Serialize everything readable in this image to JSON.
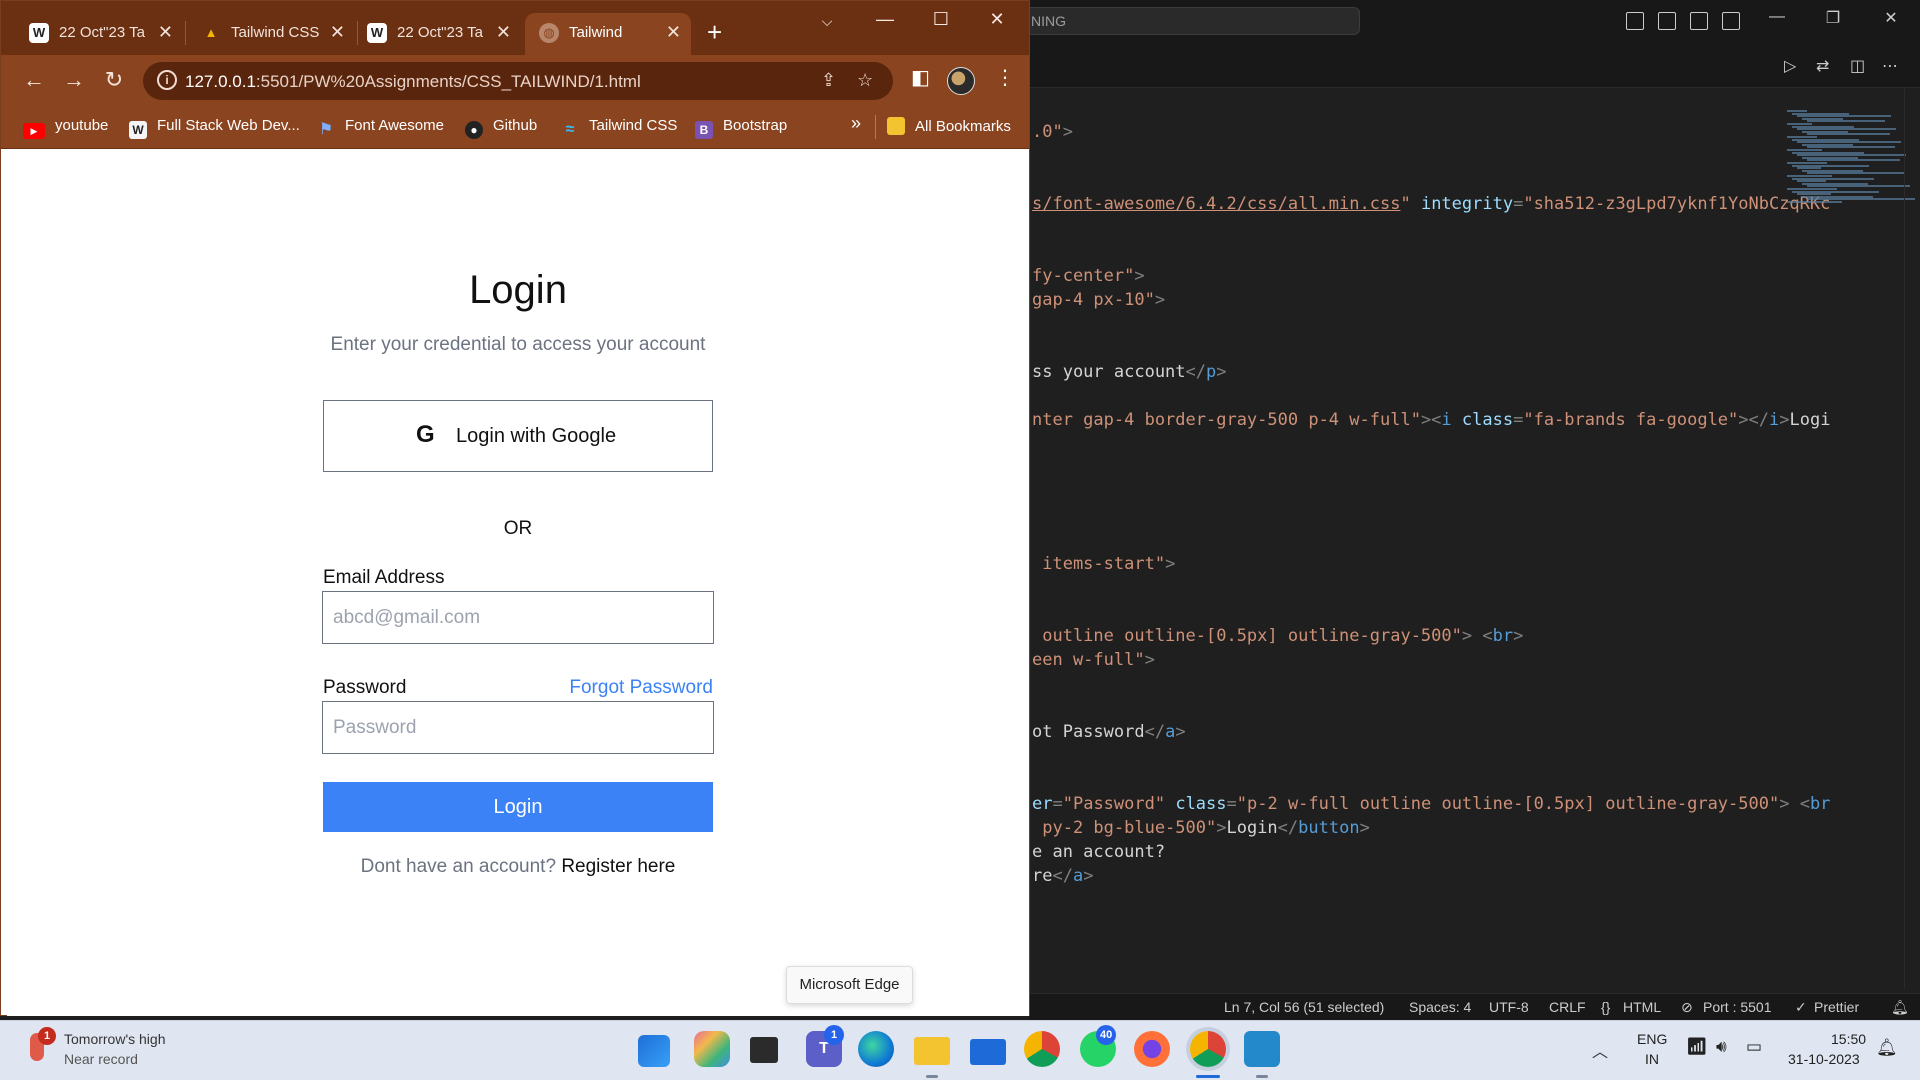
{
  "vscode": {
    "search_text": "NING",
    "code_lines": [
      {
        "segments": [
          {
            "t": ".0\"",
            "c": "c-str"
          },
          {
            "t": ">",
            "c": "c-tag"
          }
        ]
      },
      {
        "segments": [
          {
            "t": "s/font-awesome/6.4.2/css/all.min.css",
            "c": "c-link"
          },
          {
            "t": "\" ",
            "c": "c-str"
          },
          {
            "t": "integrity",
            "c": "c-attr"
          },
          {
            "t": "=",
            "c": "c-tag"
          },
          {
            "t": "\"sha512-z3gLpd7yknf1YoNbCzqRKc",
            "c": "c-str"
          }
        ]
      },
      {
        "segments": [
          {
            "t": "fy-center\"",
            "c": "c-str"
          },
          {
            "t": ">",
            "c": "c-tag"
          }
        ]
      },
      {
        "segments": [
          {
            "t": "gap-4 px-10\"",
            "c": "c-str"
          },
          {
            "t": ">",
            "c": "c-tag"
          }
        ]
      },
      {
        "segments": [
          {
            "t": "ss your account",
            "c": ""
          },
          {
            "t": "</",
            "c": "c-tag"
          },
          {
            "t": "p",
            "c": "c-tagname"
          },
          {
            "t": ">",
            "c": "c-tag"
          }
        ]
      },
      {
        "segments": [
          {
            "t": "nter gap-4 border-gray-500 p-4 w-full\"",
            "c": "c-str"
          },
          {
            "t": "><",
            "c": "c-tag"
          },
          {
            "t": "i ",
            "c": "c-tagname"
          },
          {
            "t": "class",
            "c": "c-attr"
          },
          {
            "t": "=",
            "c": "c-tag"
          },
          {
            "t": "\"fa-brands fa-google\"",
            "c": "c-str"
          },
          {
            "t": "></",
            "c": "c-tag"
          },
          {
            "t": "i",
            "c": "c-tagname"
          },
          {
            "t": ">",
            "c": "c-tag"
          },
          {
            "t": "Logi",
            "c": ""
          }
        ]
      },
      {
        "segments": [
          {
            "t": " items-start\"",
            "c": "c-str"
          },
          {
            "t": ">",
            "c": "c-tag"
          }
        ]
      },
      {
        "segments": [
          {
            "t": " outline outline-[0.5px] outline-gray-500\"",
            "c": "c-str"
          },
          {
            "t": "> <",
            "c": "c-tag"
          },
          {
            "t": "br",
            "c": "c-tagname"
          },
          {
            "t": ">",
            "c": "c-tag"
          }
        ]
      },
      {
        "segments": [
          {
            "t": "een w-full\"",
            "c": "c-str"
          },
          {
            "t": ">",
            "c": "c-tag"
          }
        ]
      },
      {
        "segments": [
          {
            "t": "ot Password",
            "c": ""
          },
          {
            "t": "</",
            "c": "c-tag"
          },
          {
            "t": "a",
            "c": "c-tagname"
          },
          {
            "t": ">",
            "c": "c-tag"
          }
        ]
      },
      {
        "segments": [
          {
            "t": "er",
            "c": "c-attr"
          },
          {
            "t": "=",
            "c": "c-tag"
          },
          {
            "t": "\"Password\" ",
            "c": "c-str"
          },
          {
            "t": "class",
            "c": "c-attr"
          },
          {
            "t": "=",
            "c": "c-tag"
          },
          {
            "t": "\"p-2 w-full outline outline-[0.5px] outline-gray-500\"",
            "c": "c-str"
          },
          {
            "t": "> <",
            "c": "c-tag"
          },
          {
            "t": "br",
            "c": "c-tagname"
          }
        ]
      },
      {
        "segments": [
          {
            "t": " py-2 bg-blue-500\"",
            "c": "c-str"
          },
          {
            "t": ">",
            "c": "c-tag"
          },
          {
            "t": "Login",
            "c": ""
          },
          {
            "t": "</",
            "c": "c-tag"
          },
          {
            "t": "button",
            "c": "c-tagname"
          },
          {
            "t": ">",
            "c": "c-tag"
          }
        ]
      },
      {
        "segments": [
          {
            "t": "e an account?",
            "c": ""
          }
        ]
      },
      {
        "segments": [
          {
            "t": "re",
            "c": ""
          },
          {
            "t": "</",
            "c": "c-tag"
          },
          {
            "t": "a",
            "c": "c-tagname"
          },
          {
            "t": ">",
            "c": "c-tag"
          }
        ]
      }
    ],
    "status": {
      "position": "Ln 7, Col 56 (51 selected)",
      "spaces": "Spaces: 4",
      "encoding": "UTF-8",
      "eol": "CRLF",
      "language": "HTML",
      "port": "Port : 5501",
      "prettier": "Prettier"
    }
  },
  "chrome": {
    "tabs": [
      {
        "label": "22 Oct\"23 Ta",
        "favicon": "wordpress-icon",
        "active": false
      },
      {
        "label": "Tailwind CSS",
        "favicon": "google-drive-icon",
        "active": false
      },
      {
        "label": "22 Oct\"23 Ta",
        "favicon": "wordpress-icon",
        "active": false
      },
      {
        "label": "Tailwind",
        "favicon": "globe-icon",
        "active": true
      }
    ],
    "url_host": "127.0.0.1",
    "url_path": ":5501/PW%20Assignments/CSS_TAILWIND/1.html",
    "bookmarks": [
      {
        "label": "youtube",
        "icon": "youtube-icon",
        "color": "#ff0000"
      },
      {
        "label": "Full Stack Web Dev...",
        "icon": "wordpress-icon",
        "color": "#3a3a3a"
      },
      {
        "label": "Font Awesome",
        "icon": "flag-icon",
        "color": "#538dd7"
      },
      {
        "label": "Github",
        "icon": "github-icon",
        "color": "#222222"
      },
      {
        "label": "Tailwind CSS",
        "icon": "tailwind-icon",
        "color": "#38bdf8"
      },
      {
        "label": "Bootstrap",
        "icon": "bootstrap-icon",
        "color": "#7952b3"
      }
    ],
    "more_bookmarks": "»",
    "all_bookmarks": "All Bookmarks"
  },
  "page": {
    "title": "Login",
    "subtitle": "Enter your credential to access your account",
    "google_button": "Login with Google",
    "google_glyph": "G",
    "or_text": "OR",
    "email_label": "Email Address",
    "email_placeholder": "abcd@gmail.com",
    "password_label": "Password",
    "forgot_password": "Forgot Password",
    "password_placeholder": "Password",
    "login_button": "Login",
    "register_prompt": "Dont have an account?",
    "register_link": "Register here",
    "accent_color": "#3b82f6"
  },
  "tooltip": "Microsoft Edge",
  "taskbar": {
    "weather_badge": "1",
    "weather_title": "Tomorrow's high",
    "weather_subtitle": "Near record",
    "teams_badge": "1",
    "whatsapp_badge": "40",
    "lang_primary": "ENG",
    "lang_region": "IN",
    "time": "15:50",
    "date": "31-10-2023"
  }
}
